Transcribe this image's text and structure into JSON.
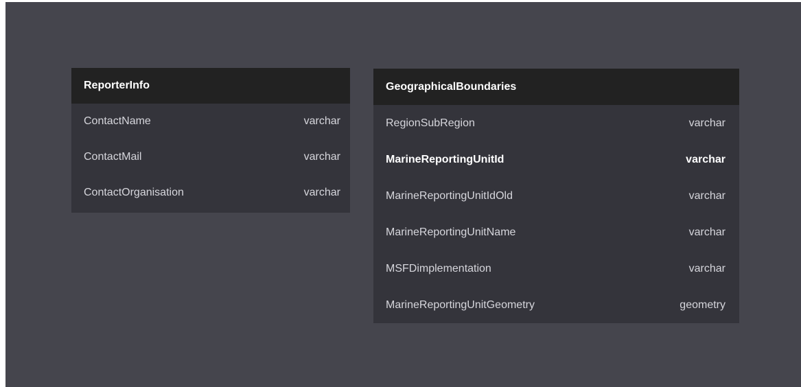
{
  "tables": [
    {
      "name": "ReporterInfo",
      "columns": [
        {
          "name": "ContactName",
          "type": "varchar",
          "key": false
        },
        {
          "name": "ContactMail",
          "type": "varchar",
          "key": false
        },
        {
          "name": "ContactOrganisation",
          "type": "varchar",
          "key": false
        }
      ]
    },
    {
      "name": "GeographicalBoundaries",
      "columns": [
        {
          "name": "RegionSubRegion",
          "type": "varchar",
          "key": false
        },
        {
          "name": "MarineReportingUnitId",
          "type": "varchar",
          "key": true
        },
        {
          "name": "MarineReportingUnitIdOld",
          "type": "varchar",
          "key": false
        },
        {
          "name": "MarineReportingUnitName",
          "type": "varchar",
          "key": false
        },
        {
          "name": "MSFDimplementation",
          "type": "varchar",
          "key": false
        },
        {
          "name": "MarineReportingUnitGeometry",
          "type": "geometry",
          "key": false
        }
      ]
    }
  ],
  "colors": {
    "canvas": "#45454d",
    "table_body": "#34343b",
    "table_header": "#222222",
    "text": "#d6d6dc",
    "text_key": "#ffffff"
  }
}
